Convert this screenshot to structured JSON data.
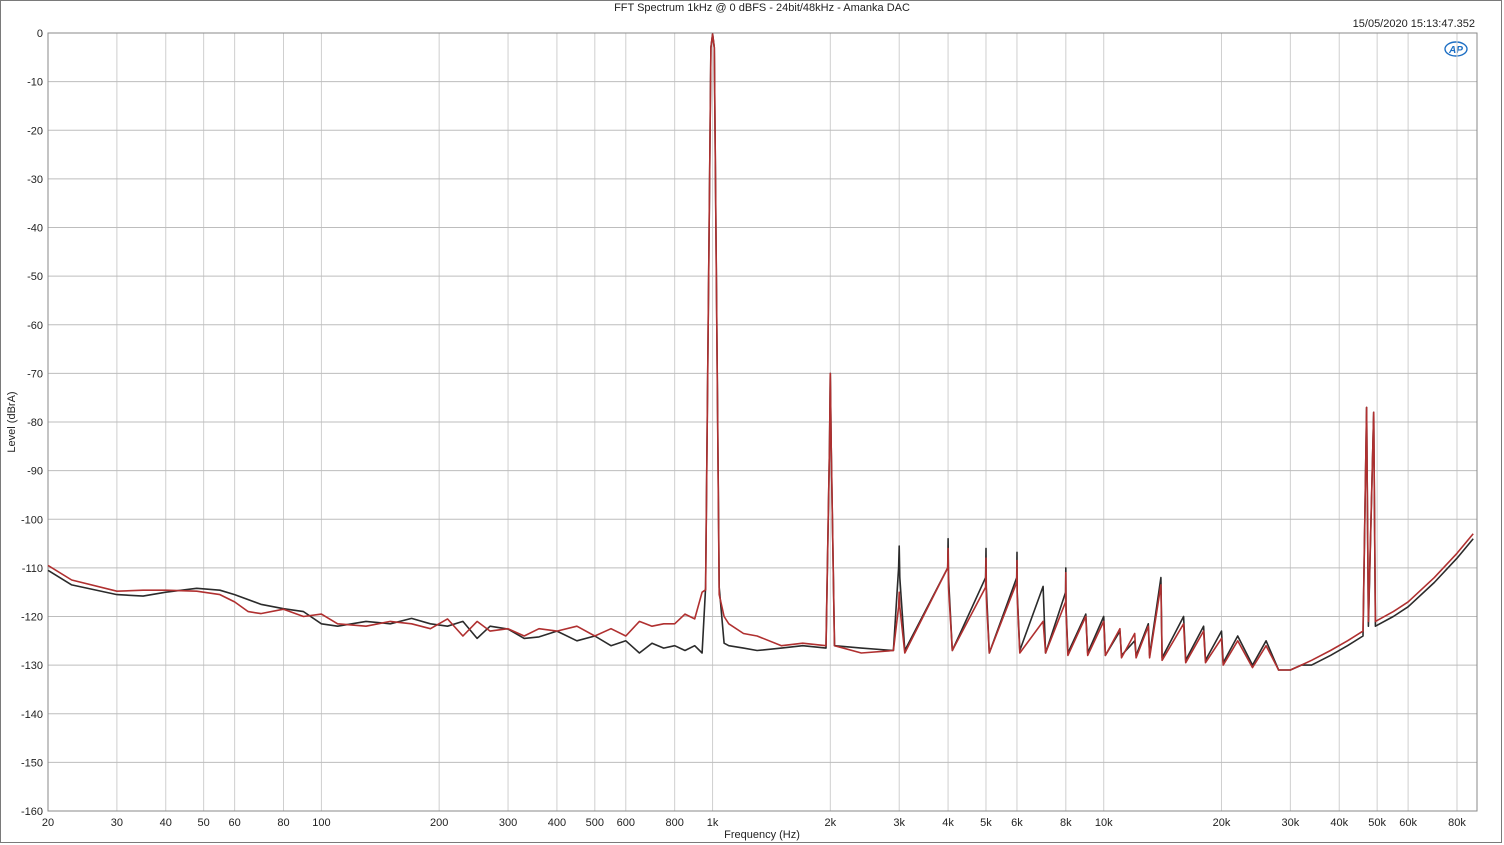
{
  "chart_data": {
    "type": "line",
    "title": "FFT Spectrum 1kHz @ 0 dBFS - 24bit/48kHz - Amanka DAC",
    "timestamp": "15/05/2020 15:13:47.352",
    "logo_text": "AP",
    "xlabel": "Frequency (Hz)",
    "ylabel": "Level (dBrA)",
    "xscale": "log",
    "xlim": [
      20,
      90000
    ],
    "ylim": [
      -160,
      0
    ],
    "grid": true,
    "x_ticks": [
      {
        "v": 20,
        "label": "20"
      },
      {
        "v": 30,
        "label": "30"
      },
      {
        "v": 40,
        "label": "40"
      },
      {
        "v": 50,
        "label": "50"
      },
      {
        "v": 60,
        "label": "60"
      },
      {
        "v": 80,
        "label": "80"
      },
      {
        "v": 100,
        "label": "100"
      },
      {
        "v": 200,
        "label": "200"
      },
      {
        "v": 300,
        "label": "300"
      },
      {
        "v": 400,
        "label": "400"
      },
      {
        "v": 500,
        "label": "500"
      },
      {
        "v": 600,
        "label": "600"
      },
      {
        "v": 800,
        "label": "800"
      },
      {
        "v": 1000,
        "label": "1k"
      },
      {
        "v": 2000,
        "label": "2k"
      },
      {
        "v": 3000,
        "label": "3k"
      },
      {
        "v": 4000,
        "label": "4k"
      },
      {
        "v": 5000,
        "label": "5k"
      },
      {
        "v": 6000,
        "label": "6k"
      },
      {
        "v": 8000,
        "label": "8k"
      },
      {
        "v": 10000,
        "label": "10k"
      },
      {
        "v": 20000,
        "label": "20k"
      },
      {
        "v": 30000,
        "label": "30k"
      },
      {
        "v": 40000,
        "label": "40k"
      },
      {
        "v": 50000,
        "label": "50k"
      },
      {
        "v": 60000,
        "label": "60k"
      },
      {
        "v": 80000,
        "label": "80k"
      }
    ],
    "y_ticks": [
      0,
      -10,
      -20,
      -30,
      -40,
      -50,
      -60,
      -70,
      -80,
      -90,
      -100,
      -110,
      -120,
      -130,
      -140,
      -150,
      -160
    ],
    "series": [
      {
        "color": "#2b2b2b",
        "points": [
          [
            20,
            -110.5
          ],
          [
            23,
            -113.5
          ],
          [
            30,
            -115.5
          ],
          [
            35,
            -115.8
          ],
          [
            40,
            -115.0
          ],
          [
            48,
            -114.2
          ],
          [
            55,
            -114.6
          ],
          [
            60,
            -115.5
          ],
          [
            70,
            -117.5
          ],
          [
            80,
            -118.4
          ],
          [
            90,
            -119.0
          ],
          [
            100,
            -121.5
          ],
          [
            110,
            -122.0
          ],
          [
            130,
            -121.0
          ],
          [
            150,
            -121.5
          ],
          [
            170,
            -120.4
          ],
          [
            190,
            -121.5
          ],
          [
            210,
            -122.0
          ],
          [
            230,
            -121.0
          ],
          [
            250,
            -124.5
          ],
          [
            270,
            -122.0
          ],
          [
            300,
            -122.6
          ],
          [
            330,
            -124.5
          ],
          [
            360,
            -124.2
          ],
          [
            400,
            -123.0
          ],
          [
            450,
            -125.0
          ],
          [
            500,
            -124.0
          ],
          [
            550,
            -126.0
          ],
          [
            600,
            -125.0
          ],
          [
            650,
            -127.5
          ],
          [
            700,
            -125.5
          ],
          [
            750,
            -126.5
          ],
          [
            800,
            -126.0
          ],
          [
            850,
            -127.0
          ],
          [
            900,
            -126.0
          ],
          [
            940,
            -127.5
          ],
          [
            960,
            -114.0
          ],
          [
            990,
            -3.0
          ],
          [
            1000,
            -0.2
          ],
          [
            1010,
            -3.0
          ],
          [
            1040,
            -114.0
          ],
          [
            1070,
            -125.5
          ],
          [
            1100,
            -126.0
          ],
          [
            1200,
            -126.5
          ],
          [
            1300,
            -127.0
          ],
          [
            1500,
            -126.5
          ],
          [
            1700,
            -126.0
          ],
          [
            1950,
            -126.5
          ],
          [
            1990,
            -85.0
          ],
          [
            2000,
            -70.0
          ],
          [
            2010,
            -85.0
          ],
          [
            2050,
            -126.0
          ],
          [
            2400,
            -126.5
          ],
          [
            2900,
            -127.0
          ],
          [
            2990,
            -110.0
          ],
          [
            3000,
            -105.5
          ],
          [
            3010,
            -112.0
          ],
          [
            3100,
            -127.0
          ],
          [
            3990,
            -110.0
          ],
          [
            4000,
            -104.0
          ],
          [
            4010,
            -112.0
          ],
          [
            4100,
            -127.0
          ],
          [
            4990,
            -112.0
          ],
          [
            5000,
            -106.0
          ],
          [
            5010,
            -114.0
          ],
          [
            5100,
            -127.5
          ],
          [
            5990,
            -112.0
          ],
          [
            6000,
            -106.8
          ],
          [
            6010,
            -115.0
          ],
          [
            6100,
            -127.0
          ],
          [
            7000,
            -113.8
          ],
          [
            7100,
            -127.5
          ],
          [
            7990,
            -115.0
          ],
          [
            8000,
            -110.0
          ],
          [
            8010,
            -118.0
          ],
          [
            8100,
            -127.5
          ],
          [
            9000,
            -119.5
          ],
          [
            9100,
            -127.5
          ],
          [
            10000,
            -120.0
          ],
          [
            10100,
            -128.0
          ],
          [
            11000,
            -123.0
          ],
          [
            11100,
            -128.0
          ],
          [
            12000,
            -125.0
          ],
          [
            12100,
            -128.0
          ],
          [
            13000,
            -121.5
          ],
          [
            13100,
            -128.0
          ],
          [
            14000,
            -112.0
          ],
          [
            14100,
            -128.5
          ],
          [
            16000,
            -120.0
          ],
          [
            16200,
            -129.0
          ],
          [
            18000,
            -122.0
          ],
          [
            18200,
            -129.0
          ],
          [
            20000,
            -123.0
          ],
          [
            20200,
            -129.5
          ],
          [
            22000,
            -124.0
          ],
          [
            24000,
            -130.0
          ],
          [
            26000,
            -125.0
          ],
          [
            28000,
            -131.0
          ],
          [
            30000,
            -131.0
          ],
          [
            32000,
            -130.0
          ],
          [
            34000,
            -130.0
          ],
          [
            38000,
            -128.0
          ],
          [
            42000,
            -126.0
          ],
          [
            46000,
            -124.0
          ],
          [
            47000,
            -77.0
          ],
          [
            47500,
            -122.0
          ],
          [
            49000,
            -78.0
          ],
          [
            49500,
            -122.0
          ],
          [
            55000,
            -120.0
          ],
          [
            60000,
            -118.0
          ],
          [
            70000,
            -113.0
          ],
          [
            80000,
            -108.0
          ],
          [
            88000,
            -104.0
          ]
        ]
      },
      {
        "color": "#b03030",
        "points": [
          [
            20,
            -109.5
          ],
          [
            23,
            -112.5
          ],
          [
            30,
            -114.8
          ],
          [
            35,
            -114.6
          ],
          [
            40,
            -114.6
          ],
          [
            48,
            -114.8
          ],
          [
            55,
            -115.5
          ],
          [
            60,
            -117.0
          ],
          [
            65,
            -119.0
          ],
          [
            70,
            -119.4
          ],
          [
            80,
            -118.5
          ],
          [
            90,
            -120.0
          ],
          [
            100,
            -119.5
          ],
          [
            110,
            -121.5
          ],
          [
            130,
            -122.0
          ],
          [
            150,
            -121.0
          ],
          [
            170,
            -121.5
          ],
          [
            190,
            -122.5
          ],
          [
            210,
            -120.5
          ],
          [
            230,
            -124.0
          ],
          [
            250,
            -121.0
          ],
          [
            270,
            -123.0
          ],
          [
            300,
            -122.5
          ],
          [
            330,
            -124.0
          ],
          [
            360,
            -122.5
          ],
          [
            400,
            -123.0
          ],
          [
            450,
            -122.0
          ],
          [
            500,
            -124.0
          ],
          [
            550,
            -122.5
          ],
          [
            600,
            -124.0
          ],
          [
            650,
            -121.0
          ],
          [
            700,
            -122.0
          ],
          [
            750,
            -121.5
          ],
          [
            800,
            -121.5
          ],
          [
            850,
            -119.5
          ],
          [
            900,
            -120.5
          ],
          [
            940,
            -115.0
          ],
          [
            960,
            -114.5
          ],
          [
            990,
            -3.0
          ],
          [
            1000,
            -0.2
          ],
          [
            1010,
            -3.0
          ],
          [
            1040,
            -115.5
          ],
          [
            1070,
            -120.0
          ],
          [
            1100,
            -121.5
          ],
          [
            1200,
            -123.5
          ],
          [
            1300,
            -124.0
          ],
          [
            1500,
            -126.0
          ],
          [
            1700,
            -125.5
          ],
          [
            1950,
            -126.0
          ],
          [
            1990,
            -85.0
          ],
          [
            2000,
            -70.0
          ],
          [
            2010,
            -85.0
          ],
          [
            2050,
            -126.0
          ],
          [
            2400,
            -127.5
          ],
          [
            2900,
            -127.0
          ],
          [
            2990,
            -118.0
          ],
          [
            3000,
            -115.0
          ],
          [
            3010,
            -118.0
          ],
          [
            3100,
            -127.5
          ],
          [
            3990,
            -110.0
          ],
          [
            4000,
            -106.0
          ],
          [
            4010,
            -114.0
          ],
          [
            4100,
            -127.0
          ],
          [
            4990,
            -114.0
          ],
          [
            5000,
            -108.0
          ],
          [
            5010,
            -116.0
          ],
          [
            5100,
            -127.5
          ],
          [
            5990,
            -113.0
          ],
          [
            6000,
            -108.5
          ],
          [
            6010,
            -116.0
          ],
          [
            6100,
            -127.5
          ],
          [
            7000,
            -121.0
          ],
          [
            7100,
            -127.5
          ],
          [
            7990,
            -117.0
          ],
          [
            8000,
            -111.0
          ],
          [
            8010,
            -119.0
          ],
          [
            8100,
            -128.0
          ],
          [
            9000,
            -120.0
          ],
          [
            9100,
            -128.0
          ],
          [
            10000,
            -121.0
          ],
          [
            10100,
            -128.0
          ],
          [
            11000,
            -122.5
          ],
          [
            11100,
            -128.5
          ],
          [
            12000,
            -123.5
          ],
          [
            12100,
            -128.5
          ],
          [
            13000,
            -122.0
          ],
          [
            13100,
            -128.5
          ],
          [
            14000,
            -113.5
          ],
          [
            14100,
            -129.0
          ],
          [
            16000,
            -121.5
          ],
          [
            16200,
            -129.5
          ],
          [
            18000,
            -123.0
          ],
          [
            18200,
            -129.5
          ],
          [
            20000,
            -124.5
          ],
          [
            20200,
            -130.0
          ],
          [
            22000,
            -125.0
          ],
          [
            24000,
            -130.5
          ],
          [
            26000,
            -126.0
          ],
          [
            28000,
            -131.0
          ],
          [
            30000,
            -131.0
          ],
          [
            32000,
            -130.0
          ],
          [
            34000,
            -129.0
          ],
          [
            38000,
            -127.0
          ],
          [
            42000,
            -125.0
          ],
          [
            46000,
            -123.0
          ],
          [
            47000,
            -77.0
          ],
          [
            47500,
            -121.0
          ],
          [
            49000,
            -78.0
          ],
          [
            49500,
            -121.0
          ],
          [
            55000,
            -119.0
          ],
          [
            60000,
            -117.0
          ],
          [
            70000,
            -112.0
          ],
          [
            80000,
            -107.0
          ],
          [
            88000,
            -103.0
          ]
        ]
      }
    ]
  }
}
